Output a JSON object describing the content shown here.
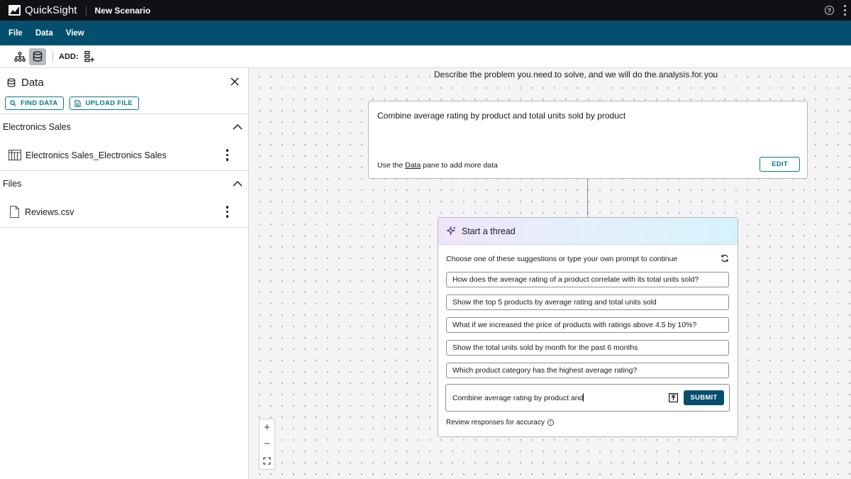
{
  "app": {
    "name": "QuickSight",
    "scenario_name": "New Scenario"
  },
  "menu": [
    "File",
    "Data",
    "View"
  ],
  "toolbar": {
    "add_label": "ADD:"
  },
  "data_panel": {
    "title": "Data",
    "find_data_label": "FIND DATA",
    "upload_file_label": "UPLOAD FILE",
    "sections": [
      {
        "title": "Electronics Sales",
        "items": [
          {
            "label": "Electronics Sales_Electronics Sales",
            "icon": "table-icon"
          }
        ]
      },
      {
        "title": "Files",
        "items": [
          {
            "label": "Reviews.csv",
            "icon": "file-icon"
          }
        ]
      }
    ]
  },
  "canvas": {
    "hint": "Describe the problem you need to solve, and we will do the analysis for you",
    "prompt_card": {
      "text": "Combine average rating by product and total units sold by product",
      "footer_pre": "Use the ",
      "footer_link": "Data",
      "footer_post": " pane to add more data",
      "edit_label": "EDIT"
    },
    "thread": {
      "title": "Start a thread",
      "choose_text": "Choose one of these suggestions or type your own prompt to continue",
      "suggestions": [
        "How does the average rating of a product correlate with its total units sold?",
        "Show the top 5 products by average rating and total units sold",
        "What if we increased the price of products with ratings above 4.5 by 10%?",
        "Show the total units sold by month for the past 6 months",
        "Which product category has the highest average rating?"
      ],
      "input_value": "Combine average rating by product and",
      "submit_label": "SUBMIT",
      "review_text": "Review responses for accuracy"
    },
    "zoom": {
      "in": "+",
      "out": "−"
    }
  },
  "colors": {
    "menubar": "#044f6e",
    "accent": "#06788f",
    "topbar": "#0f1115"
  }
}
